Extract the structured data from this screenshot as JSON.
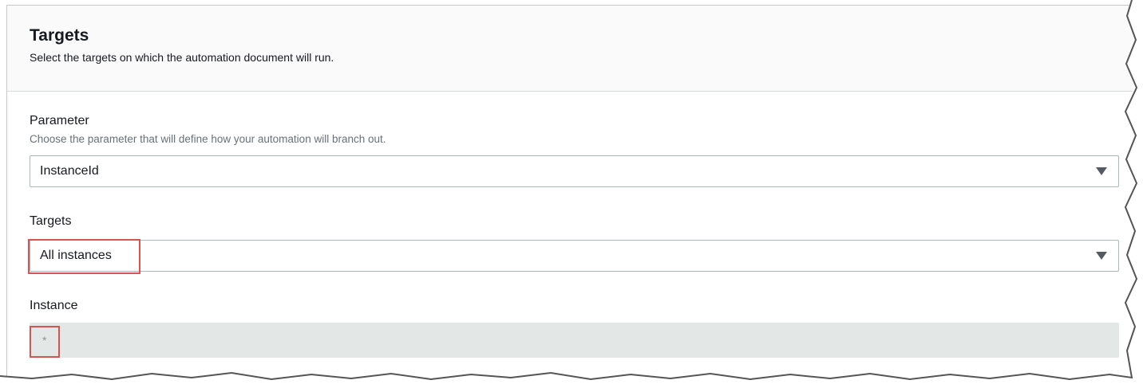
{
  "section": {
    "title": "Targets",
    "description": "Select the targets on which the automation document will run."
  },
  "parameter_field": {
    "label": "Parameter",
    "hint": "Choose the parameter that will define how your automation will branch out.",
    "selected": "InstanceId"
  },
  "targets_field": {
    "label": "Targets",
    "selected": "All instances"
  },
  "instance_field": {
    "label": "Instance",
    "value": "*"
  },
  "colors": {
    "highlight": "#d9534f",
    "readonly_bg": "#e3e7e6",
    "header_bg": "#fafafa"
  }
}
